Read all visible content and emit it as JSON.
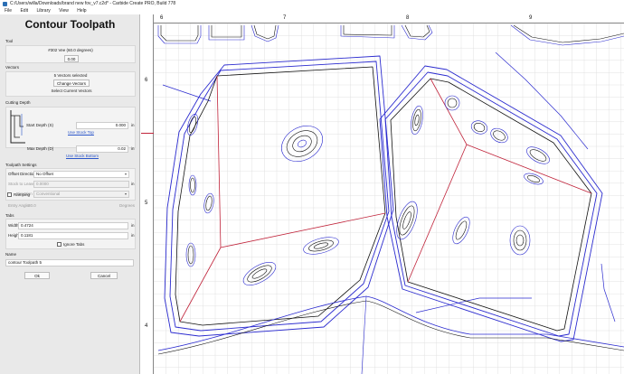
{
  "window": {
    "title": "C:/Users/willa/Downloads/brand new fov_v7.c2d* - Carbide Create PRO, Build 778",
    "menu": [
      "File",
      "Edit",
      "Library",
      "View",
      "Help"
    ]
  },
  "panel": {
    "title": "Contour Toolpath",
    "tool": {
      "section": "Tool",
      "name": "#302 Vee (60.0 degrees)",
      "value": "0.00"
    },
    "vectors": {
      "section": "Vectors",
      "selected_text": "5 Vectors selected",
      "change_button": "Change Vectors",
      "select_current_button": "Select Current Vectors"
    },
    "cutting_depth": {
      "section": "Cutting Depth",
      "start_label": "Start Depth (S)",
      "start_value": "0.000",
      "start_unit": "in",
      "use_stock_top": "Use Stock Top",
      "max_label": "Max Depth (D)",
      "max_value": "0.02",
      "max_unit": "in",
      "use_stock_bottom": "Use Stock Bottom"
    },
    "toolpath_settings": {
      "section": "Toolpath Settings",
      "offset_label": "Offset Direction",
      "offset_value": "No Offset",
      "stock_label": "Stock to Leave",
      "stock_value": "0.0000",
      "stock_unit": "in",
      "direction_label": "Direction",
      "direction_value": "Conventional"
    },
    "ramping": {
      "checkbox_label": "Ramping",
      "entry_label": "Entry Angle",
      "entry_value": "30.0",
      "entry_unit": "Degrees"
    },
    "tabs": {
      "section": "Tabs",
      "width_label": "Width",
      "width_value": "0.4724",
      "width_unit": "in",
      "height_label": "Height",
      "height_value": "0.1181",
      "height_unit": "in",
      "ignore_label": "Ignore Tabs"
    },
    "name": {
      "section": "Name",
      "value": "contour Toolpath 5"
    },
    "ok_button": "Ok",
    "cancel_button": "Cancel"
  },
  "rulers": {
    "top": [
      "6",
      "7",
      "8",
      "9"
    ],
    "left": [
      "6",
      "5",
      "4"
    ]
  },
  "colors": {
    "vector_blue": "#2b2bcf",
    "toolpath_black": "#111111",
    "selected_red": "#c0233a",
    "grid": "#e1e1e1"
  }
}
